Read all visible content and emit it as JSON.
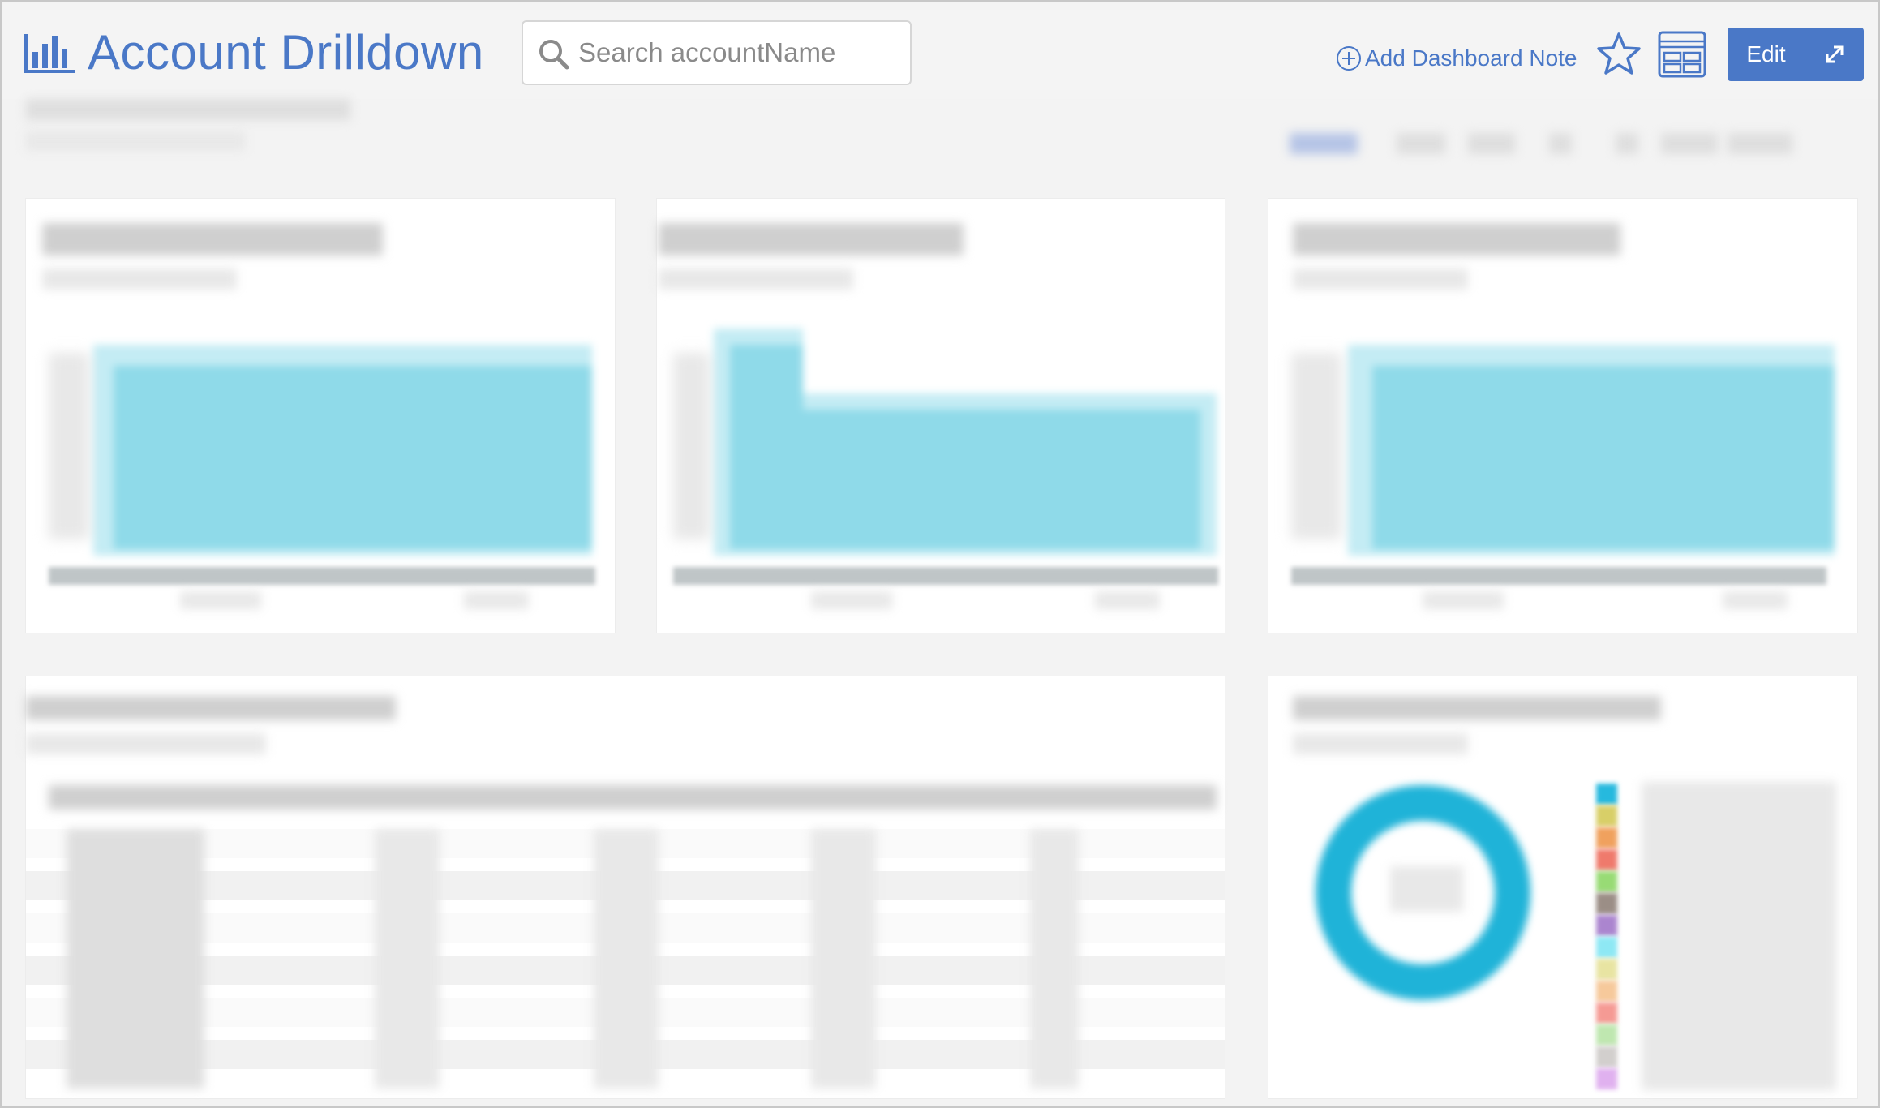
{
  "header": {
    "title": "Account Drilldown",
    "search_placeholder": "Search accountName",
    "add_note_label": "Add Dashboard Note",
    "edit_label": "Edit"
  },
  "colors": {
    "brand": "#4a78c7",
    "chart_area": "#8fdae9",
    "donut": "#1fb3d8",
    "legend": [
      "#26b9de",
      "#d8cf68",
      "#f0a15e",
      "#ef7a6c",
      "#98db75",
      "#9b8e86",
      "#ab85cf",
      "#8ee8f4",
      "#e8e4a2",
      "#f6c99b",
      "#f59a94",
      "#bfe7b0",
      "#d2cfcd",
      "#e0b1ef"
    ]
  },
  "icons": [
    "bar-chart-icon",
    "search-icon",
    "plus-circle-icon",
    "star-icon",
    "layout-grid-icon",
    "expand-icon"
  ]
}
